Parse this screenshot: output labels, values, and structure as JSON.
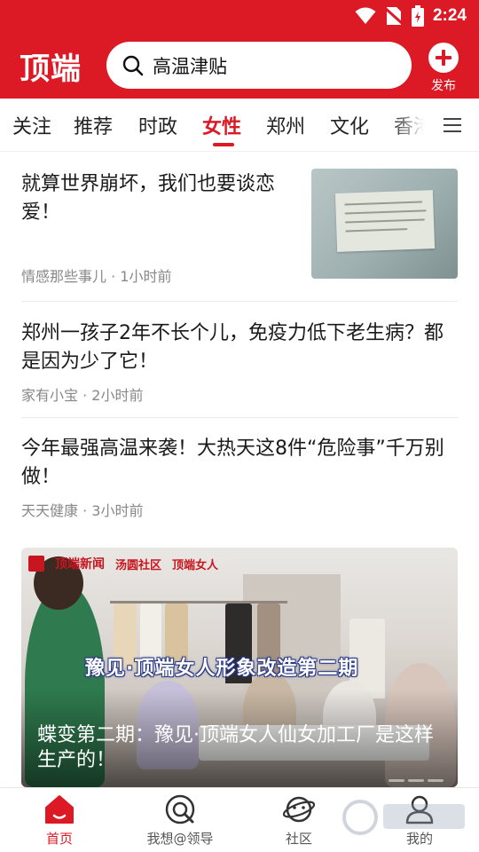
{
  "status_bar": {
    "time": "2:24"
  },
  "header": {
    "logo": "顶端",
    "search": {
      "query": "高温津贴"
    },
    "publish_label": "发布"
  },
  "tabs": [
    {
      "label": "关注",
      "active": false
    },
    {
      "label": "推荐",
      "active": false
    },
    {
      "label": "时政",
      "active": false
    },
    {
      "label": "女性",
      "active": true
    },
    {
      "label": "郑州",
      "active": false
    },
    {
      "label": "文化",
      "active": false
    },
    {
      "label": "香港",
      "active": false
    }
  ],
  "feed": [
    {
      "title": "就算世界崩坏，我们也要谈恋爱！",
      "source": "情感那些事儿",
      "time": "1小时前",
      "has_thumbnail": true
    },
    {
      "title": "郑州一孩子2年不长个儿，免疫力低下老生病？都是因为少了它！",
      "source": "家有小宝",
      "time": "2小时前",
      "has_thumbnail": false
    },
    {
      "title": "今年最强高温来袭！大热天这8件“危险事”千万别做！",
      "source": "天天健康",
      "time": "3小时前",
      "has_thumbnail": false
    }
  ],
  "video_card": {
    "brands": [
      "顶端新闻",
      "汤圆社区",
      "顶端女人"
    ],
    "banner_text": "豫见·顶端女人形象改造第二期",
    "caption": "蝶变第二期：豫见·顶端女人仙女加工厂是这样生产的！"
  },
  "bottom_nav": [
    {
      "label": "首页",
      "icon": "home-icon",
      "active": true
    },
    {
      "label": "我想@领导",
      "icon": "at-search-icon",
      "active": false
    },
    {
      "label": "社区",
      "icon": "planet-icon",
      "active": false
    },
    {
      "label": "我的",
      "icon": "user-icon",
      "active": false
    }
  ],
  "colors": {
    "brand_red": "#dc1a26",
    "meta_gray": "#888888"
  }
}
